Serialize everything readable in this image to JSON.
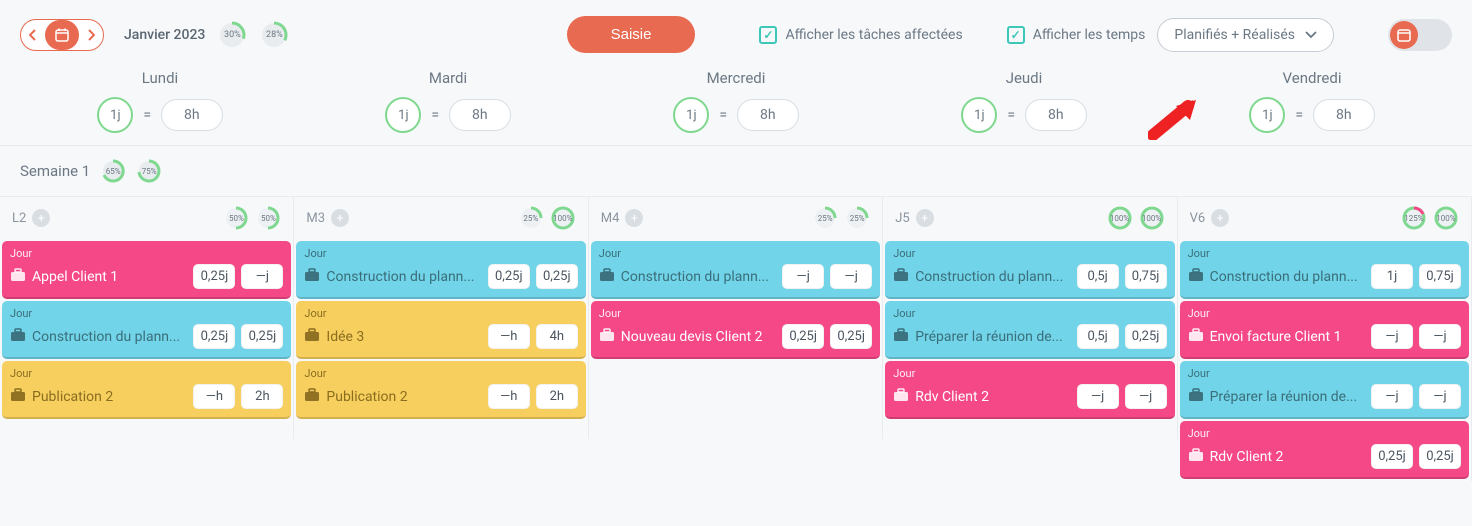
{
  "header": {
    "month": "Janvier 2023",
    "pct1": "30%",
    "pct2": "28%",
    "saisie": "Saisie",
    "chk1": "Afficher les tâches affectées",
    "chk2": "Afficher les temps",
    "dropdown": "Planifiés + Réalisés"
  },
  "days": [
    {
      "name": "Lundi",
      "unit": "1j",
      "hours": "8h"
    },
    {
      "name": "Mardi",
      "unit": "1j",
      "hours": "8h"
    },
    {
      "name": "Mercredi",
      "unit": "1j",
      "hours": "8h"
    },
    {
      "name": "Jeudi",
      "unit": "1j",
      "hours": "8h"
    },
    {
      "name": "Vendredi",
      "unit": "1j",
      "hours": "8h"
    }
  ],
  "week": {
    "label": "Semaine 1",
    "pct1": "65%",
    "pct2": "75%"
  },
  "cols": [
    {
      "code": "L2",
      "pct1": "50%",
      "pct2": "50%"
    },
    {
      "code": "M3",
      "pct1": "25%",
      "pct2": "100%"
    },
    {
      "code": "M4",
      "pct1": "25%",
      "pct2": "25%"
    },
    {
      "code": "J5",
      "pct1": "100%",
      "pct2": "100%"
    },
    {
      "code": "V6",
      "pct1": "125%",
      "pct2": "100%"
    }
  ],
  "tasks": [
    [
      {
        "color": "pink",
        "tag": "Jour",
        "title": "Appel Client 1",
        "v1": "0,25j",
        "v2": "—j"
      },
      {
        "color": "cyan",
        "tag": "Jour",
        "title": "Construction du plann...",
        "v1": "0,25j",
        "v2": "0,25j"
      },
      {
        "color": "yellow",
        "tag": "Jour",
        "title": "Publication 2",
        "v1": "—h",
        "v2": "2h"
      }
    ],
    [
      {
        "color": "cyan",
        "tag": "Jour",
        "title": "Construction du plann...",
        "v1": "0,25j",
        "v2": "0,25j"
      },
      {
        "color": "yellow",
        "tag": "Jour",
        "title": "Idée 3",
        "v1": "—h",
        "v2": "4h"
      },
      {
        "color": "yellow",
        "tag": "Jour",
        "title": "Publication 2",
        "v1": "—h",
        "v2": "2h"
      }
    ],
    [
      {
        "color": "cyan",
        "tag": "Jour",
        "title": "Construction du plann...",
        "v1": "—j",
        "v2": "—j"
      },
      {
        "color": "pink",
        "tag": "Jour",
        "title": "Nouveau devis Client 2",
        "v1": "0,25j",
        "v2": "0,25j"
      }
    ],
    [
      {
        "color": "cyan",
        "tag": "Jour",
        "title": "Construction du plann...",
        "v1": "0,5j",
        "v2": "0,75j"
      },
      {
        "color": "cyan",
        "tag": "Jour",
        "title": "Préparer la réunion de...",
        "v1": "0,5j",
        "v2": "0,25j"
      },
      {
        "color": "pink",
        "tag": "Jour",
        "title": "Rdv Client 2",
        "v1": "—j",
        "v2": "—j"
      }
    ],
    [
      {
        "color": "cyan",
        "tag": "Jour",
        "title": "Construction du plann...",
        "v1": "1j",
        "v2": "0,75j"
      },
      {
        "color": "pink",
        "tag": "Jour",
        "title": "Envoi facture Client 1",
        "v1": "—j",
        "v2": "—j"
      },
      {
        "color": "cyan",
        "tag": "Jour",
        "title": "Préparer la réunion de...",
        "v1": "—j",
        "v2": "—j"
      },
      {
        "color": "pink",
        "tag": "Jour",
        "title": "Rdv Client 2",
        "v1": "0,25j",
        "v2": "0,25j"
      }
    ]
  ]
}
